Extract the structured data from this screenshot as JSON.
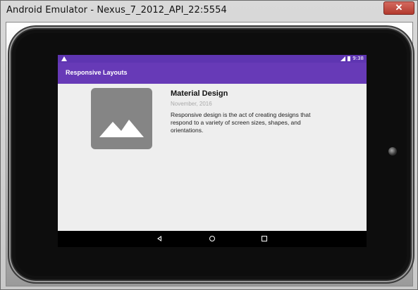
{
  "window": {
    "title": "Android Emulator - Nexus_7_2012_API_22:5554",
    "close_label": "✕"
  },
  "status_bar": {
    "time": "9:38",
    "icons": [
      "warning-icon",
      "signal-icon",
      "battery-icon"
    ]
  },
  "app_bar": {
    "title": "Responsive Layouts"
  },
  "card": {
    "image_icon": "image-placeholder-icon",
    "headline": "Material Design",
    "date": "November, 2016",
    "body": "Responsive design is the act of creating designs that respond to a variety of screen sizes, shapes, and orientations."
  },
  "nav_bar": {
    "buttons": [
      "back-icon",
      "home-icon",
      "recents-icon"
    ]
  },
  "colors": {
    "status_bar": "#5e35b1",
    "app_bar": "#673ab7",
    "screen_background": "#eeeeee",
    "placeholder": "#858585"
  }
}
